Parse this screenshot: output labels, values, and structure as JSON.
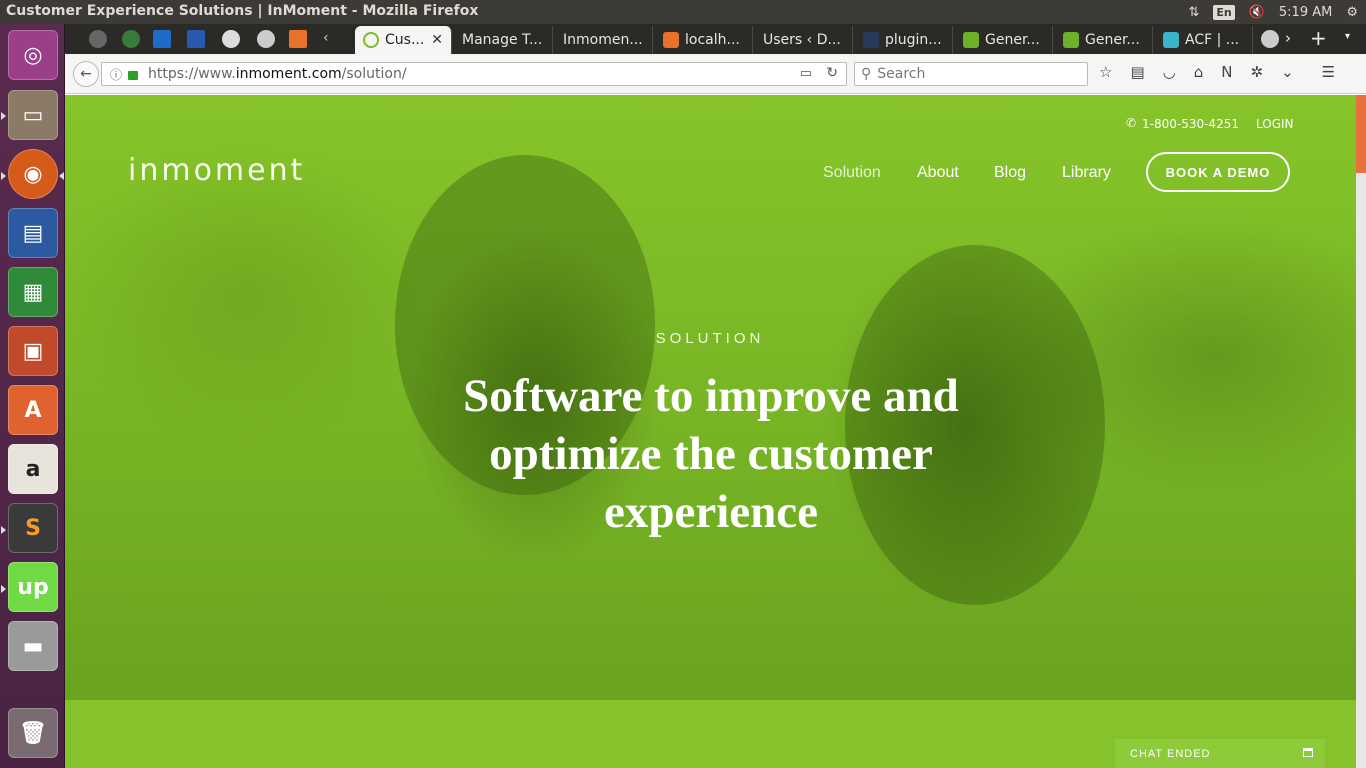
{
  "window": {
    "title": "Customer Experience Solutions | InMoment - Mozilla Firefox"
  },
  "panel": {
    "keyboard": "En",
    "time": "5:19 AM"
  },
  "tabs": [
    {
      "label": "Cus...",
      "active": true
    },
    {
      "label": "Manage T..."
    },
    {
      "label": "Inmomen..."
    },
    {
      "label": "localh..."
    },
    {
      "label": "Users ‹ D..."
    },
    {
      "label": "plugin..."
    },
    {
      "label": "Gener..."
    },
    {
      "label": "Gener..."
    },
    {
      "label": "ACF | ..."
    }
  ],
  "address": {
    "scheme": "https://www.",
    "domain": "inmoment.com",
    "path": "/solution/"
  },
  "search": {
    "placeholder": "Search"
  },
  "site": {
    "logo": "inmoment",
    "phone": "1-800-530-4251",
    "login": "LOGIN",
    "nav": {
      "solution": "Solution",
      "about": "About",
      "blog": "Blog",
      "library": "Library"
    },
    "demo_button": "BOOK A DEMO",
    "eyebrow": "SOLUTION",
    "headline": "Software to improve and optimize the customer experience",
    "chat": "CHAT ENDED"
  },
  "colors": {
    "brand_green": "#7dbd26",
    "scroll_accent": "#e8703d"
  }
}
